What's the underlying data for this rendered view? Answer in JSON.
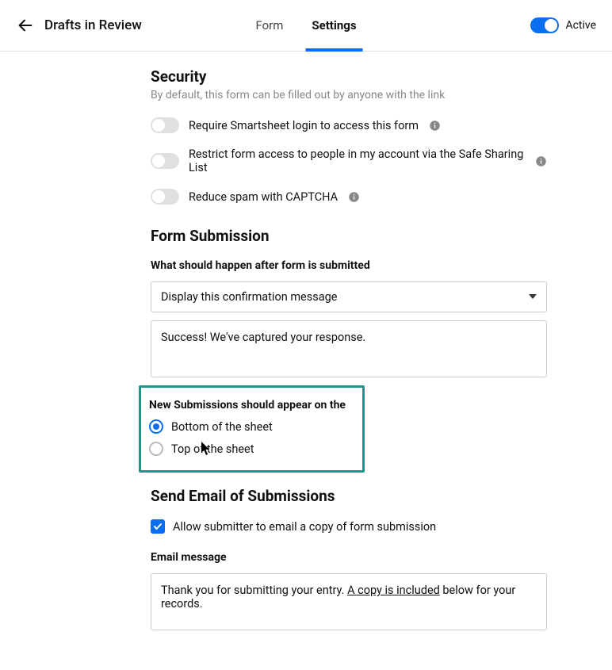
{
  "header": {
    "title": "Drafts in Review",
    "tabs": {
      "form": "Form",
      "settings": "Settings"
    },
    "active_label": "Active"
  },
  "security": {
    "title": "Security",
    "subtitle": "By default, this form can be filled out by anyone with the link",
    "require_login": "Require Smartsheet login to access this form",
    "restrict_access": "Restrict form access to people in my account via the Safe Sharing List",
    "captcha": "Reduce spam with CAPTCHA"
  },
  "submission": {
    "title": "Form Submission",
    "after_label": "What should happen after form is submitted",
    "confirmation_option": "Display this confirmation message",
    "confirmation_message": "Success! We've captured your response.",
    "position_label": "New Submissions should appear on the",
    "bottom": "Bottom of the sheet",
    "top": "Top of the sheet"
  },
  "email": {
    "title": "Send Email of Submissions",
    "allow_label": "Allow submitter to email a copy of form submission",
    "message_label": "Email message",
    "message_pre": "Thank you for submitting your entry. ",
    "message_link": "A copy is included",
    "message_post": " below for your records."
  }
}
